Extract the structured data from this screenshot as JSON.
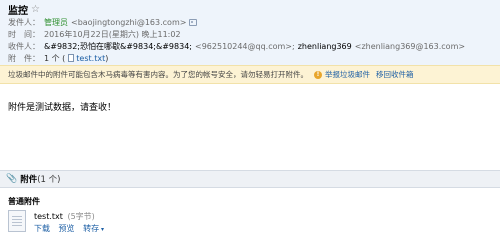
{
  "header": {
    "subject": "监控",
    "star_glyph": "☆",
    "sender_label": "发件人：",
    "sender_name": "管理员",
    "sender_addr": "<baojingtongzhi@163.com>",
    "time_label": "时　间：",
    "time_value": "2016年10月22日(星期六) 晚上11:02",
    "recipient_label": "收件人：",
    "recipient_1": "&#9832;恐怕在哪歇&#9834;&#9834;",
    "recipient_1_addr": "<962510244@qq.com>;",
    "recipient_2": "zhenliang369",
    "recipient_2_addr": "<zhenliang369@163.com>",
    "attachment_label": "附　件：",
    "attachment_count": "1 个 (",
    "attachment_file": "test.txt",
    "attachment_close": ")"
  },
  "warning": {
    "text": "垃圾邮件中的附件可能包含木马病毒等有害内容。为了您的帐号安全，请勿轻易打开附件。",
    "icon": "!",
    "report_link": "举报垃圾邮件",
    "move_link": "移回收件箱"
  },
  "body": {
    "text": "附件是测试数据，请查收！"
  },
  "attachments": {
    "title": "附件",
    "count": "(1 个)",
    "section_label": "普通附件",
    "file_name": "test.txt",
    "file_size": "(5字节)",
    "actions": [
      "下载",
      "预览",
      "转存"
    ]
  },
  "colors": {
    "header_bg": "#eef4fb",
    "sender_green": "#2f8f2f",
    "link_blue": "#1d5fa5",
    "warn_bg": "#fdf3d4"
  }
}
